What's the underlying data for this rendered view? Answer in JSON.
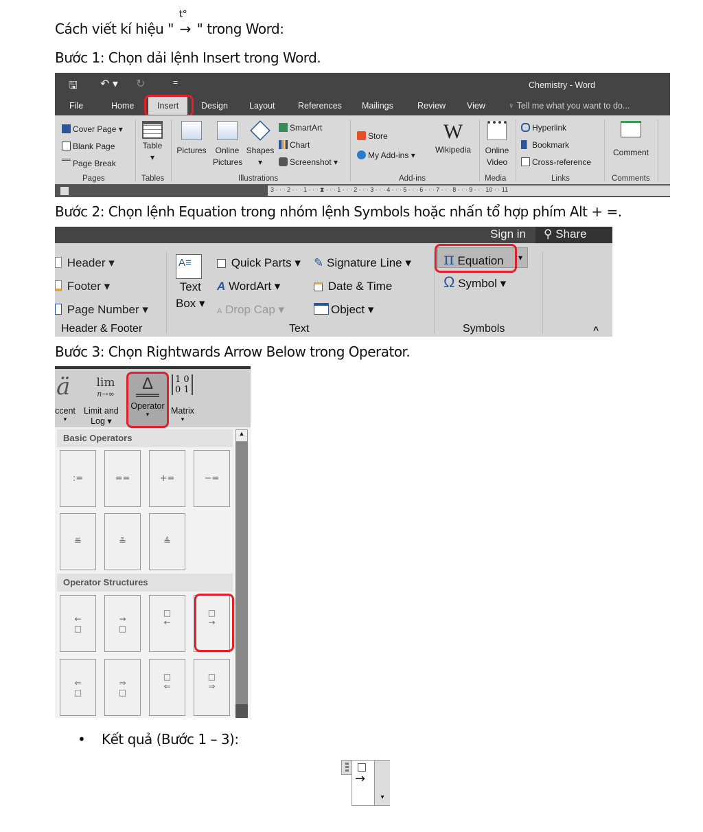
{
  "doc": {
    "heading_prefix": "Cách viết kí hiệu \"",
    "heading_symbol_top": "t°",
    "heading_symbol_arrow": "→",
    "heading_suffix": "\" trong Word:",
    "step1": "Bước 1: Chọn dải lệnh Insert trong Word.",
    "step2": "Bước 2: Chọn lệnh Equation trong nhóm lệnh Symbols hoặc nhấn tổ hợp phím Alt + =.",
    "step3": "Bước 3: Chọn Rightwards Arrow Below trong Operator.",
    "result": "Kết quả (Bước 1 – 3):",
    "bullet": "•"
  },
  "word1": {
    "title": "Chemistry - Word",
    "qat": {
      "save": "save-icon",
      "undo": "undo-icon",
      "redo": "redo-icon",
      "customize": "="
    },
    "tabs": [
      "File",
      "Home",
      "Insert",
      "Design",
      "Layout",
      "References",
      "Mailings",
      "Review",
      "View"
    ],
    "tell_me": "Tell me what you want to do...",
    "pages": {
      "items": [
        "Cover Page ▾",
        "Blank Page",
        "Page Break"
      ],
      "label": "Pages"
    },
    "tables": {
      "item": "Table",
      "arrow": "▾",
      "label": "Tables"
    },
    "illustrations": {
      "pictures": "Pictures",
      "online1": "Online",
      "online2": "Pictures",
      "shapes": "Shapes",
      "arrow": "▾",
      "smartart": "SmartArt",
      "chart": "Chart",
      "screenshot": "Screenshot ▾",
      "label": "Illustrations"
    },
    "addins": {
      "store": "Store",
      "myaddins": "My Add-ins  ▾",
      "wiki_glyph": "W",
      "wikipedia": "Wikipedia",
      "label": "Add-ins"
    },
    "media": {
      "l1": "Online",
      "l2": "Video",
      "label": "Media"
    },
    "links": {
      "items": [
        "Hyperlink",
        "Bookmark",
        "Cross-reference"
      ],
      "label": "Links"
    },
    "comments": {
      "item": "Comment",
      "label": "Comments"
    },
    "ruler": "3 · · · 2 · · · 1 · · · ⧗ · · · 1 · · · 2 · · · 3 · · · 4 · · · 5 · · · 6 · · · 7 · · · 8 · · · 9 · · · 10 · · 11"
  },
  "word2": {
    "sign_in": "Sign in",
    "share": "Share",
    "hf": {
      "items": [
        "Header ▾",
        "Footer ▾",
        "Page Number ▾"
      ],
      "label": "Header & Footer"
    },
    "text": {
      "textbox1": "Text",
      "textbox2": "Box ▾",
      "quickparts": "Quick Parts ▾",
      "wordart": "WordArt ▾",
      "dropcap": "Drop Cap ▾",
      "signature": "Signature Line  ▾",
      "datetime": "Date & Time",
      "object": "Object  ▾",
      "label": "Text"
    },
    "symbols": {
      "equation": "Equation",
      "eq_glyph": "π",
      "eq_arrow": "▾",
      "symbol": "Symbol ▾",
      "sym_glyph": "Ω",
      "label": "Symbols"
    },
    "collapse": "^"
  },
  "eq": {
    "accent_glyph": "ä",
    "accent": "ccent",
    "limit_glyph": "lim",
    "limit_sub": "n→∞",
    "limit1": "Limit and",
    "limit2": "Log ▾",
    "operator_glyph": "Δ",
    "operator": "Operator",
    "matrix_glyph": "[1 0; 0 1]",
    "matrix_r1": "1 0",
    "matrix_r2": "0 1",
    "matrix": "Matrix",
    "arrow": "▾",
    "basic_header": "Basic Operators",
    "basic": [
      ":=",
      "==",
      "+=",
      "−=",
      "≝",
      "≞",
      "≜"
    ],
    "struct_header": "Operator Structures",
    "structures": [
      "⃖",
      "⃗",
      "←",
      "→",
      "⇐",
      "⇒",
      "⇐",
      "⇒"
    ],
    "colors": {
      "highlight": "#e0202a",
      "accent_blue": "#2b5797"
    }
  },
  "result_box": {
    "arrow": "→",
    "dropdown": "▾"
  }
}
